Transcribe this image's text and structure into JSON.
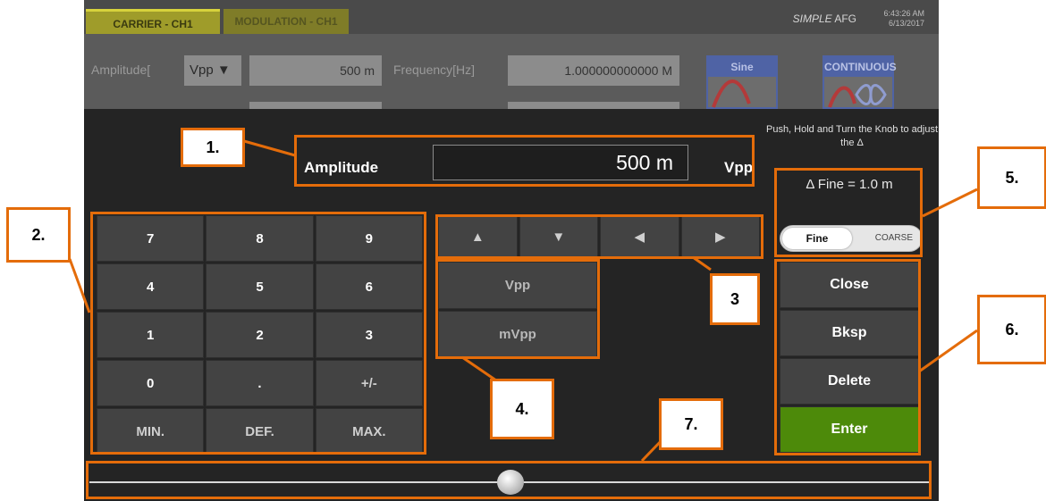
{
  "app": {
    "tabs": [
      "CARRIER - CH1",
      "MODULATION - CH1"
    ],
    "brand_italic": "SIMPLE",
    "brand_rest": " AFG",
    "time": "6:43:26 AM",
    "date": "6/13/2017"
  },
  "settings": {
    "amplitude_label": "Amplitude[",
    "amplitude_unit": "Vpp ▼",
    "amplitude_value": "500 m",
    "frequency_label": "Frequency[Hz]",
    "frequency_value": "1.000000000000 M",
    "waveform": "Sine",
    "run_mode": "CONTINUOUS"
  },
  "dialog": {
    "hint": "Push, Hold and Turn the Knob to adjust the Δ",
    "field_label": "Amplitude",
    "field_value": "500 m",
    "field_unit": "Vpp",
    "delta_text": "Δ Fine = 1.0 m",
    "toggle_on": "Fine",
    "toggle_off": "COARSE",
    "keypad": [
      "7",
      "8",
      "9",
      "4",
      "5",
      "6",
      "1",
      "2",
      "3",
      "0",
      ".",
      "+/-",
      "MIN.",
      "DEF.",
      "MAX."
    ],
    "arrows": [
      "▲",
      "▼",
      "◀",
      "▶"
    ],
    "units": [
      "Vpp",
      "mVpp"
    ],
    "side_buttons": [
      "Close",
      "Bksp",
      "Delete",
      "Enter"
    ],
    "slider_level": 0.5
  },
  "annotations": [
    "1.",
    "2.",
    "3",
    "4.",
    "5.",
    "6.",
    "7."
  ],
  "colors": {
    "annotation": "#e46c0a",
    "enter": "#4d8a0a",
    "tab_yellow": "#d7d23c"
  }
}
